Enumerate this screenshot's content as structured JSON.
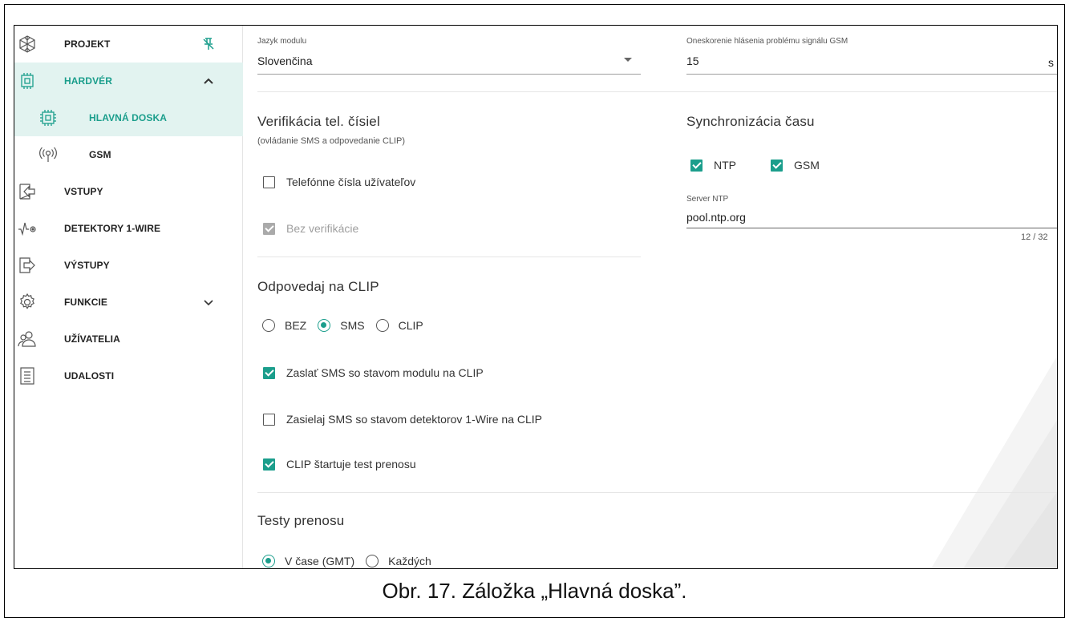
{
  "sidebar": {
    "items": [
      {
        "label": "PROJEKT",
        "icon": "snowflake-icon"
      },
      {
        "label": "HARDVÉR",
        "icon": "chip-icon"
      },
      {
        "label": "HLAVNÁ DOSKA",
        "icon": "chip-icon"
      },
      {
        "label": "GSM",
        "icon": "antenna-icon"
      },
      {
        "label": "VSTUPY",
        "icon": "input-icon"
      },
      {
        "label": "DETEKTORY 1-WIRE",
        "icon": "pulse-icon"
      },
      {
        "label": "VÝSTUPY",
        "icon": "output-icon"
      },
      {
        "label": "FUNKCIE",
        "icon": "gear-icon"
      },
      {
        "label": "UŽÍVATELIA",
        "icon": "users-icon"
      },
      {
        "label": "UDALOSTI",
        "icon": "document-icon"
      }
    ],
    "pin_icon": "pin-icon",
    "expand_icons": [
      "chevron-up-icon",
      "chevron-down-icon"
    ]
  },
  "module_language": {
    "label": "Jazyk modulu",
    "value": "Slovenčina"
  },
  "gsm_delay": {
    "label": "Oneskorenie hlásenia problému signálu GSM",
    "value": "15",
    "unit": "s"
  },
  "verification": {
    "title": "Verifikácia tel. čísiel",
    "subtitle": "(ovládanie SMS a odpovedanie CLIP)",
    "user_numbers": {
      "label": "Telefónne čísla užívateľov",
      "checked": false
    },
    "no_verification": {
      "label": "Bez verifikácie",
      "checked": true,
      "disabled": true
    }
  },
  "time_sync": {
    "title": "Synchronizácia času",
    "ntp": {
      "label": "NTP",
      "checked": true
    },
    "gsm": {
      "label": "GSM",
      "checked": true
    },
    "server_label": "Server NTP",
    "server_value": "pool.ntp.org",
    "counter": "12 / 32"
  },
  "clip": {
    "title": "Odpovedaj na CLIP",
    "options": [
      {
        "label": "BEZ",
        "selected": false
      },
      {
        "label": "SMS",
        "selected": true
      },
      {
        "label": "CLIP",
        "selected": false
      }
    ],
    "send_module_state": {
      "label": "Zaslať SMS so stavom modulu na CLIP",
      "checked": true
    },
    "send_detector_state": {
      "label": "Zasielaj SMS so stavom detektorov 1-Wire na CLIP",
      "checked": false
    },
    "clip_starts_test": {
      "label": "CLIP štartuje test prenosu",
      "checked": true
    }
  },
  "tests": {
    "title": "Testy prenosu",
    "options": [
      {
        "label": "V čase (GMT)",
        "selected": true
      },
      {
        "label": "Každých",
        "selected": false
      }
    ]
  },
  "colors": {
    "accent": "#1b9e8c",
    "active_bg": "#e2f3f0"
  },
  "caption": "Obr. 17. Záložka „Hlavná doska”."
}
